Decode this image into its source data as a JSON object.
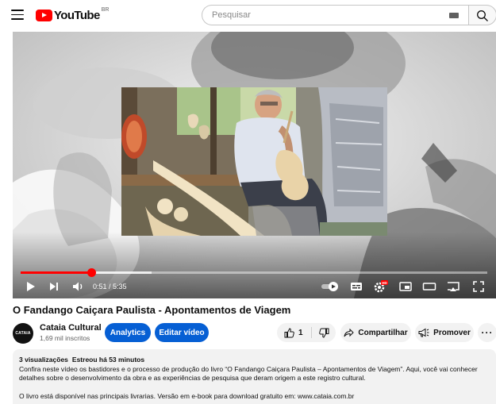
{
  "header": {
    "logo_text": "YouTube",
    "logo_country": "BR",
    "search_placeholder": "Pesquisar"
  },
  "player": {
    "time_current": "0:51",
    "time_separator": " / ",
    "time_total": "5:35",
    "progress_fraction": 0.152,
    "buffered_fraction": 0.28
  },
  "video": {
    "title": "O Fandango Caiçara Paulista - Apontamentos de Viagem"
  },
  "channel": {
    "avatar_text": "CATAIA",
    "name": "Cataia Cultural",
    "subscribers": "1,69 mil inscritos"
  },
  "actions": {
    "analytics_label": "Analytics",
    "edit_label": "Editar vídeo",
    "like_count": "1",
    "share_label": "Compartilhar",
    "promote_label": "Promover",
    "more_label": "···"
  },
  "description": {
    "views": "3 visualizações",
    "premiered": "Estreou há 53 minutos",
    "line1": "Confira neste vídeo os bastidores e o processo de produção do livro “O Fandango Caiçara Paulista – Apontamentos de Viagem”. Aqui, você vai conhecer detalhes sobre o desenvolvimento da obra e as experiências de pesquisa que deram origem a este registro cultural.",
    "line2": "O livro está disponível nas principais livrarias. Versão em e-book para download gratuito em: www.cataia.com.br"
  },
  "colors": {
    "brand_red": "#ff0000",
    "action_blue": "#065fd4",
    "chip_gray": "#f2f2f2"
  }
}
